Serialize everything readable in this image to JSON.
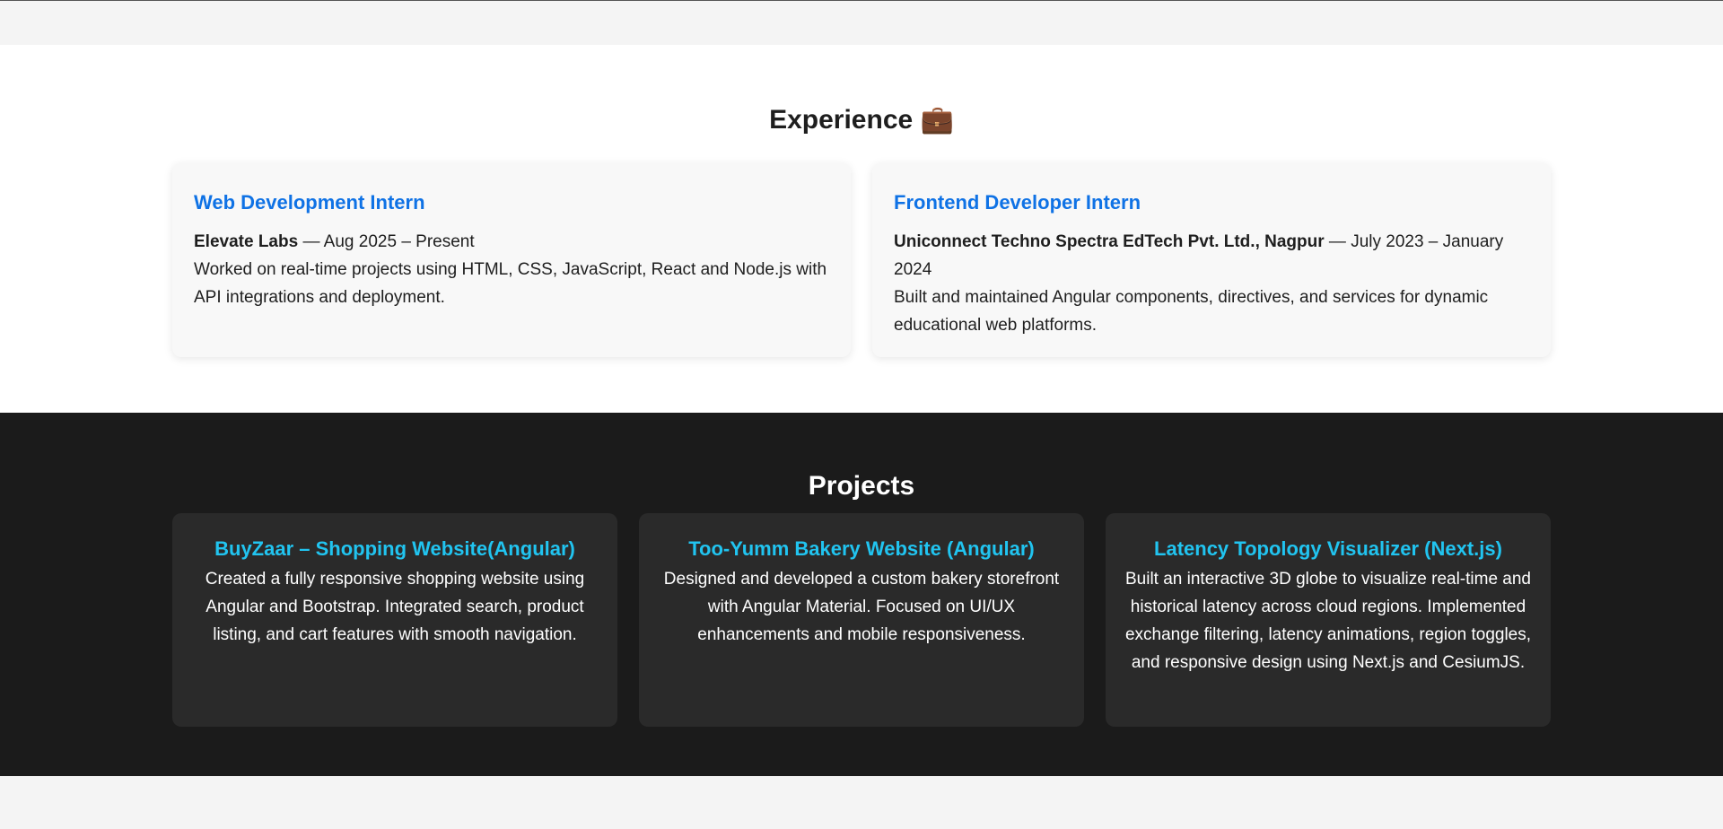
{
  "experience": {
    "title": "Experience",
    "title_icon": "💼",
    "cards": [
      {
        "role": "Web Development Intern",
        "company": "Elevate Labs",
        "period": " — Aug 2025 – Present",
        "description": "Worked on real-time projects using HTML, CSS, JavaScript, React and Node.js with API integrations and deployment."
      },
      {
        "role": "Frontend Developer Intern",
        "company": "Uniconnect Techno Spectra EdTech Pvt. Ltd., Nagpur",
        "period": " — July 2023 – January 2024",
        "description": "Built and maintained Angular components, directives, and services for dynamic educational web platforms."
      }
    ]
  },
  "projects": {
    "title": "Projects",
    "cards": [
      {
        "name": "BuyZaar – Shopping Website(Angular)",
        "description": "Created a fully responsive shopping website using Angular and Bootstrap. Integrated search, product listing, and cart features with smooth navigation."
      },
      {
        "name": "Too-Yumm Bakery Website (Angular)",
        "description": "Designed and developed a custom bakery storefront with Angular Material. Focused on UI/UX enhancements and mobile responsiveness."
      },
      {
        "name": "Latency Topology Visualizer (Next.js)",
        "description": "Built an interactive 3D globe to visualize real-time and historical latency across cloud regions. Implemented exchange filtering, latency animations, region toggles, and responsive design using Next.js and CesiumJS."
      }
    ]
  },
  "colors": {
    "role_blue": "#0f72e5",
    "project_cyan": "#21c4f0",
    "dark_bg": "#1b1b1b",
    "card_dark": "#2a2a2a"
  }
}
